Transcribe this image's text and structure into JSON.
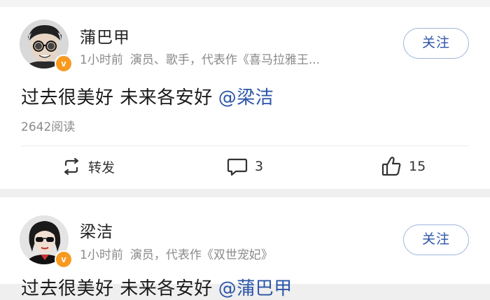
{
  "posts": [
    {
      "user": {
        "name": "蒲巴甲",
        "verified_badge": "v",
        "avatar_icon": "avatar-man-sunglasses"
      },
      "time": "1小时前",
      "description": "演员、歌手，代表作《喜马拉雅王...",
      "follow_label": "关注",
      "text": "过去很美好 未来各安好",
      "mention": "@梁洁",
      "reads": "2642阅读",
      "actions": {
        "repost_label": "转发",
        "comment_count": "3",
        "like_count": "15"
      }
    },
    {
      "user": {
        "name": "梁洁",
        "verified_badge": "v",
        "avatar_icon": "avatar-woman-sunglasses"
      },
      "time": "1小时前",
      "description": "演员，代表作《双世宠妃》",
      "follow_label": "关注",
      "text": "过去很美好 未来各安好",
      "mention": "@蒲巴甲"
    }
  ],
  "colors": {
    "link": "#2c55a8",
    "verified": "#f79a1f",
    "meta": "#8a8a8a",
    "separator": "#efefef"
  },
  "icons": {
    "repost": "repost-icon",
    "comment": "comment-icon",
    "like": "thumbs-up-icon"
  }
}
